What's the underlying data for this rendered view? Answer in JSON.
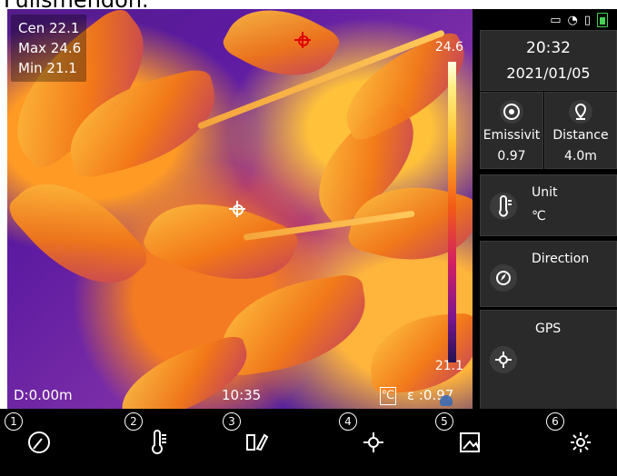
{
  "header": {
    "text": "Fullsmendon."
  },
  "viewport": {
    "readouts": [
      {
        "label": "Cen",
        "value": "22.1"
      },
      {
        "label": "Max",
        "value": "24.6"
      },
      {
        "label": "Min",
        "value": "21.1"
      }
    ],
    "scale_max": "24.6",
    "scale_min": "21.1",
    "distance": "D:0.00m",
    "time": "10:35",
    "unit_icon": "℃",
    "emissivity": "ε :0.97"
  },
  "panel": {
    "time": "20:32",
    "date": "2021/01/05",
    "emissivity": {
      "label": "Emissivit",
      "value": "0.97"
    },
    "distance": {
      "label": "Distance",
      "value": "4.0m"
    },
    "unit": {
      "label": "Unit",
      "value": "℃"
    },
    "direction": {
      "label": "Direction"
    },
    "gps": {
      "label": "GPS"
    }
  },
  "toolbar": {
    "items": [
      {
        "number": "1",
        "icon": "gauge-icon"
      },
      {
        "number": "2",
        "icon": "thermometer-icon"
      },
      {
        "number": "3",
        "icon": "palette-icon"
      },
      {
        "number": "4",
        "icon": "crosshair-icon"
      },
      {
        "number": "5",
        "icon": "image-icon"
      },
      {
        "number": "6",
        "icon": "settings-icon"
      }
    ]
  },
  "colors": {
    "hot": "#ffc12e",
    "cold": "#241151",
    "panel_bg": "#000000",
    "card_bg": "#2a2a2a",
    "battery": "#45d255"
  }
}
